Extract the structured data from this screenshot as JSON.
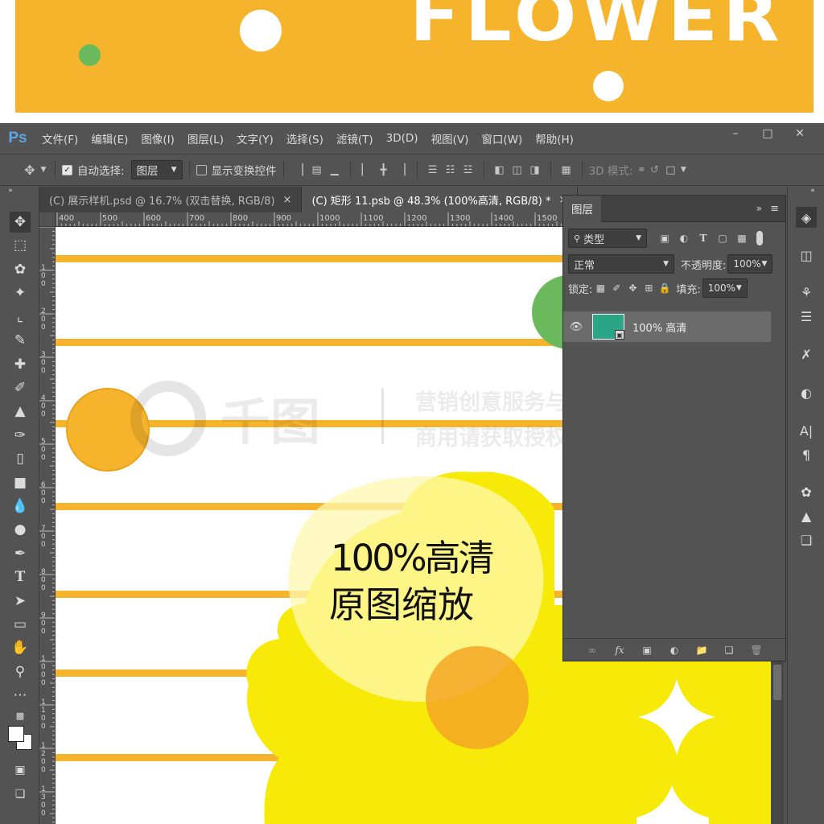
{
  "banner": {
    "title": "FLOWER",
    "colors": {
      "background": "#f6b42d",
      "dot_green": "#6ab95c",
      "dot_white": "#ffffff"
    }
  },
  "app": {
    "logo": "Ps",
    "menu": [
      "文件(F)",
      "编辑(E)",
      "图像(I)",
      "图层(L)",
      "文字(Y)",
      "选择(S)",
      "滤镜(T)",
      "3D(D)",
      "视图(V)",
      "窗口(W)",
      "帮助(H)"
    ],
    "window_controls": {
      "minimize": "–",
      "maximize": "□",
      "close": "✕"
    }
  },
  "options_bar": {
    "tool_icon": "move-icon",
    "auto_select_label": "自动选择:",
    "auto_select_checked": true,
    "auto_select_value": "图层",
    "show_transform_label": "显示变换控件",
    "show_transform_checked": false,
    "mode_3d_label": "3D 模式:"
  },
  "tabs": [
    {
      "label": "(C) 展示样机.psd @ 16.7% (双击替换, RGB/8)",
      "close": "×",
      "active": false
    },
    {
      "label": "(C) 矩形 11.psb @ 48.3% (100%高清, RGB/8) *",
      "close": "×",
      "active": true
    }
  ],
  "ruler": {
    "horizontal": [
      "400",
      "500",
      "600",
      "700",
      "800",
      "900",
      "1000",
      "1100",
      "1200",
      "1300",
      "1400",
      "1500"
    ],
    "vertical": [
      "100",
      "200",
      "300",
      "400",
      "500",
      "600",
      "700",
      "800",
      "900",
      "1000",
      "1100",
      "1200",
      "1300"
    ]
  },
  "canvas": {
    "overlay_line1": "100%高清",
    "overlay_line2": "原图缩放",
    "watermark_brand": "千图",
    "watermark_line1": "营销创意服务与协作平台",
    "watermark_line2": "商用请获取授权",
    "colors": {
      "stripe": "#f6b42d",
      "flower": "#f8ea08",
      "flower_center": "#f5a623",
      "bubble": "#fff8b0",
      "green": "#6ab95c"
    }
  },
  "layers_panel": {
    "title": "图层",
    "filter_label": "类型",
    "blend_mode": "正常",
    "opacity_label": "不透明度:",
    "opacity_value": "100%",
    "lock_label": "锁定:",
    "fill_label": "填充:",
    "fill_value": "100%",
    "layers": [
      {
        "name": "100% 高清",
        "visible": true,
        "thumb_color": "#2aa585"
      }
    ]
  }
}
